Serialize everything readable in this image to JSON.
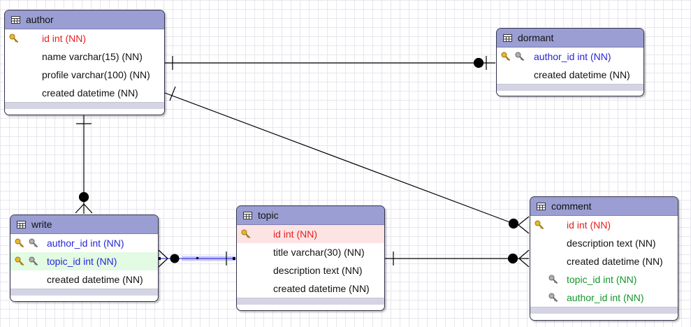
{
  "diagram": {
    "tables": {
      "author": {
        "name": "author",
        "columns": [
          {
            "text": "id int (NN)",
            "kind": "pk"
          },
          {
            "text": "name varchar(15) (NN)",
            "kind": "plain"
          },
          {
            "text": "profile varchar(100) (NN)",
            "kind": "plain"
          },
          {
            "text": "created datetime (NN)",
            "kind": "plain"
          }
        ]
      },
      "dormant": {
        "name": "dormant",
        "columns": [
          {
            "text": "author_id int (NN)",
            "kind": "pk-fk"
          },
          {
            "text": "created datetime (NN)",
            "kind": "plain"
          }
        ]
      },
      "write": {
        "name": "write",
        "columns": [
          {
            "text": "author_id int (NN)",
            "kind": "pk-fk"
          },
          {
            "text": "topic_id int (NN)",
            "kind": "pk-fk"
          },
          {
            "text": "created datetime (NN)",
            "kind": "plain"
          }
        ]
      },
      "topic": {
        "name": "topic",
        "columns": [
          {
            "text": "id int (NN)",
            "kind": "pk"
          },
          {
            "text": "title varchar(30) (NN)",
            "kind": "plain"
          },
          {
            "text": "description text (NN)",
            "kind": "plain"
          },
          {
            "text": "created datetime (NN)",
            "kind": "plain"
          }
        ]
      },
      "comment": {
        "name": "comment",
        "columns": [
          {
            "text": "id int (NN)",
            "kind": "pk"
          },
          {
            "text": "description text (NN)",
            "kind": "plain"
          },
          {
            "text": "created datetime (NN)",
            "kind": "plain"
          },
          {
            "text": "topic_id int (NN)",
            "kind": "fk"
          },
          {
            "text": "author_id int (NN)",
            "kind": "fk"
          }
        ]
      }
    },
    "relationships": [
      {
        "from": "author",
        "to": "dormant",
        "notation": "one-to-one-or-zero"
      },
      {
        "from": "author",
        "to": "comment",
        "notation": "one-to-many"
      },
      {
        "from": "author",
        "to": "write",
        "notation": "one-to-many"
      },
      {
        "from": "topic",
        "to": "write",
        "notation": "one-to-many"
      },
      {
        "from": "topic",
        "to": "comment",
        "notation": "one-to-many"
      }
    ],
    "colors": {
      "header": "#9b9ed2",
      "primary_key_text": "#e81e1e",
      "foreign_key_text": "#2626d9",
      "foreign_key_text_alt": "#14962a",
      "selected_row_red": "#fde4e4",
      "selected_row_green": "#e2fbe2",
      "key_icon_gold": "#d9a520",
      "key_icon_gray": "#8a8a8a"
    },
    "icon_names": [
      "table-icon",
      "primary-key-icon",
      "foreign-key-icon"
    ]
  }
}
